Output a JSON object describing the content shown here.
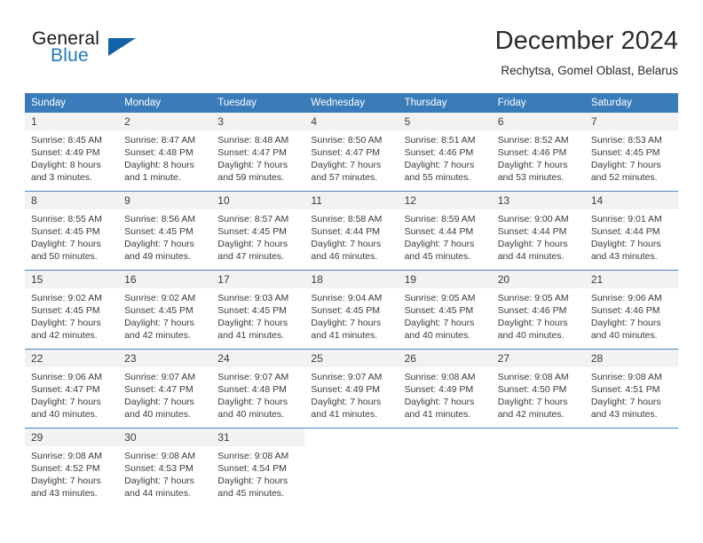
{
  "brand": {
    "name_top": "General",
    "name_bottom": "Blue",
    "triangle_icon": "triangle-icon",
    "accent_color": "#2279c0"
  },
  "header": {
    "title": "December 2024",
    "subtitle": "Rechytsa, Gomel Oblast, Belarus"
  },
  "calendar": {
    "header_bg": "#3a7cba",
    "daynum_bg": "#f2f2f2",
    "weekday_headers": [
      "Sunday",
      "Monday",
      "Tuesday",
      "Wednesday",
      "Thursday",
      "Friday",
      "Saturday"
    ],
    "weeks": [
      [
        {
          "day": "1",
          "sunrise": "Sunrise: 8:45 AM",
          "sunset": "Sunset: 4:49 PM",
          "daylight1": "Daylight: 8 hours",
          "daylight2": "and 3 minutes."
        },
        {
          "day": "2",
          "sunrise": "Sunrise: 8:47 AM",
          "sunset": "Sunset: 4:48 PM",
          "daylight1": "Daylight: 8 hours",
          "daylight2": "and 1 minute."
        },
        {
          "day": "3",
          "sunrise": "Sunrise: 8:48 AM",
          "sunset": "Sunset: 4:47 PM",
          "daylight1": "Daylight: 7 hours",
          "daylight2": "and 59 minutes."
        },
        {
          "day": "4",
          "sunrise": "Sunrise: 8:50 AM",
          "sunset": "Sunset: 4:47 PM",
          "daylight1": "Daylight: 7 hours",
          "daylight2": "and 57 minutes."
        },
        {
          "day": "5",
          "sunrise": "Sunrise: 8:51 AM",
          "sunset": "Sunset: 4:46 PM",
          "daylight1": "Daylight: 7 hours",
          "daylight2": "and 55 minutes."
        },
        {
          "day": "6",
          "sunrise": "Sunrise: 8:52 AM",
          "sunset": "Sunset: 4:46 PM",
          "daylight1": "Daylight: 7 hours",
          "daylight2": "and 53 minutes."
        },
        {
          "day": "7",
          "sunrise": "Sunrise: 8:53 AM",
          "sunset": "Sunset: 4:45 PM",
          "daylight1": "Daylight: 7 hours",
          "daylight2": "and 52 minutes."
        }
      ],
      [
        {
          "day": "8",
          "sunrise": "Sunrise: 8:55 AM",
          "sunset": "Sunset: 4:45 PM",
          "daylight1": "Daylight: 7 hours",
          "daylight2": "and 50 minutes."
        },
        {
          "day": "9",
          "sunrise": "Sunrise: 8:56 AM",
          "sunset": "Sunset: 4:45 PM",
          "daylight1": "Daylight: 7 hours",
          "daylight2": "and 49 minutes."
        },
        {
          "day": "10",
          "sunrise": "Sunrise: 8:57 AM",
          "sunset": "Sunset: 4:45 PM",
          "daylight1": "Daylight: 7 hours",
          "daylight2": "and 47 minutes."
        },
        {
          "day": "11",
          "sunrise": "Sunrise: 8:58 AM",
          "sunset": "Sunset: 4:44 PM",
          "daylight1": "Daylight: 7 hours",
          "daylight2": "and 46 minutes."
        },
        {
          "day": "12",
          "sunrise": "Sunrise: 8:59 AM",
          "sunset": "Sunset: 4:44 PM",
          "daylight1": "Daylight: 7 hours",
          "daylight2": "and 45 minutes."
        },
        {
          "day": "13",
          "sunrise": "Sunrise: 9:00 AM",
          "sunset": "Sunset: 4:44 PM",
          "daylight1": "Daylight: 7 hours",
          "daylight2": "and 44 minutes."
        },
        {
          "day": "14",
          "sunrise": "Sunrise: 9:01 AM",
          "sunset": "Sunset: 4:44 PM",
          "daylight1": "Daylight: 7 hours",
          "daylight2": "and 43 minutes."
        }
      ],
      [
        {
          "day": "15",
          "sunrise": "Sunrise: 9:02 AM",
          "sunset": "Sunset: 4:45 PM",
          "daylight1": "Daylight: 7 hours",
          "daylight2": "and 42 minutes."
        },
        {
          "day": "16",
          "sunrise": "Sunrise: 9:02 AM",
          "sunset": "Sunset: 4:45 PM",
          "daylight1": "Daylight: 7 hours",
          "daylight2": "and 42 minutes."
        },
        {
          "day": "17",
          "sunrise": "Sunrise: 9:03 AM",
          "sunset": "Sunset: 4:45 PM",
          "daylight1": "Daylight: 7 hours",
          "daylight2": "and 41 minutes."
        },
        {
          "day": "18",
          "sunrise": "Sunrise: 9:04 AM",
          "sunset": "Sunset: 4:45 PM",
          "daylight1": "Daylight: 7 hours",
          "daylight2": "and 41 minutes."
        },
        {
          "day": "19",
          "sunrise": "Sunrise: 9:05 AM",
          "sunset": "Sunset: 4:45 PM",
          "daylight1": "Daylight: 7 hours",
          "daylight2": "and 40 minutes."
        },
        {
          "day": "20",
          "sunrise": "Sunrise: 9:05 AM",
          "sunset": "Sunset: 4:46 PM",
          "daylight1": "Daylight: 7 hours",
          "daylight2": "and 40 minutes."
        },
        {
          "day": "21",
          "sunrise": "Sunrise: 9:06 AM",
          "sunset": "Sunset: 4:46 PM",
          "daylight1": "Daylight: 7 hours",
          "daylight2": "and 40 minutes."
        }
      ],
      [
        {
          "day": "22",
          "sunrise": "Sunrise: 9:06 AM",
          "sunset": "Sunset: 4:47 PM",
          "daylight1": "Daylight: 7 hours",
          "daylight2": "and 40 minutes."
        },
        {
          "day": "23",
          "sunrise": "Sunrise: 9:07 AM",
          "sunset": "Sunset: 4:47 PM",
          "daylight1": "Daylight: 7 hours",
          "daylight2": "and 40 minutes."
        },
        {
          "day": "24",
          "sunrise": "Sunrise: 9:07 AM",
          "sunset": "Sunset: 4:48 PM",
          "daylight1": "Daylight: 7 hours",
          "daylight2": "and 40 minutes."
        },
        {
          "day": "25",
          "sunrise": "Sunrise: 9:07 AM",
          "sunset": "Sunset: 4:49 PM",
          "daylight1": "Daylight: 7 hours",
          "daylight2": "and 41 minutes."
        },
        {
          "day": "26",
          "sunrise": "Sunrise: 9:08 AM",
          "sunset": "Sunset: 4:49 PM",
          "daylight1": "Daylight: 7 hours",
          "daylight2": "and 41 minutes."
        },
        {
          "day": "27",
          "sunrise": "Sunrise: 9:08 AM",
          "sunset": "Sunset: 4:50 PM",
          "daylight1": "Daylight: 7 hours",
          "daylight2": "and 42 minutes."
        },
        {
          "day": "28",
          "sunrise": "Sunrise: 9:08 AM",
          "sunset": "Sunset: 4:51 PM",
          "daylight1": "Daylight: 7 hours",
          "daylight2": "and 43 minutes."
        }
      ],
      [
        {
          "day": "29",
          "sunrise": "Sunrise: 9:08 AM",
          "sunset": "Sunset: 4:52 PM",
          "daylight1": "Daylight: 7 hours",
          "daylight2": "and 43 minutes."
        },
        {
          "day": "30",
          "sunrise": "Sunrise: 9:08 AM",
          "sunset": "Sunset: 4:53 PM",
          "daylight1": "Daylight: 7 hours",
          "daylight2": "and 44 minutes."
        },
        {
          "day": "31",
          "sunrise": "Sunrise: 9:08 AM",
          "sunset": "Sunset: 4:54 PM",
          "daylight1": "Daylight: 7 hours",
          "daylight2": "and 45 minutes."
        },
        {
          "day": "",
          "sunrise": "",
          "sunset": "",
          "daylight1": "",
          "daylight2": ""
        },
        {
          "day": "",
          "sunrise": "",
          "sunset": "",
          "daylight1": "",
          "daylight2": ""
        },
        {
          "day": "",
          "sunrise": "",
          "sunset": "",
          "daylight1": "",
          "daylight2": ""
        },
        {
          "day": "",
          "sunrise": "",
          "sunset": "",
          "daylight1": "",
          "daylight2": ""
        }
      ]
    ]
  }
}
